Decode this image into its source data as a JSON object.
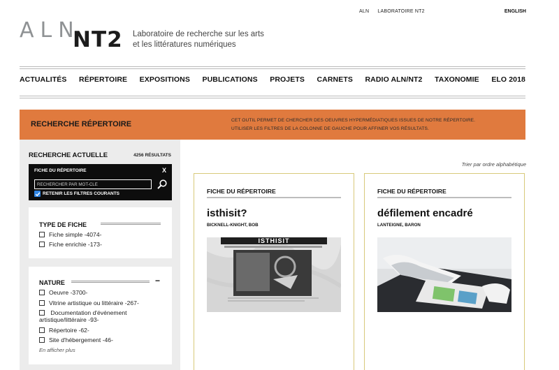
{
  "toplinks": {
    "aln": "ALN",
    "lab": "LABORATOIRE NT2",
    "lang": "ENGLISH"
  },
  "logo": {
    "part1": "ALN",
    "part2": "NT2",
    "tagline_line1": "Laboratoire de recherche sur les arts",
    "tagline_line2": "et les littératures numériques"
  },
  "nav": [
    "ACTUALITÉS",
    "RÉPERTOIRE",
    "EXPOSITIONS",
    "PUBLICATIONS",
    "PROJETS",
    "CARNETS",
    "RADIO ALN/NT2",
    "TAXONOMIE",
    "ELO 2018"
  ],
  "banner": {
    "title": "RECHERCHE RÉPERTOIRE",
    "desc_line1": "CET OUTIL PERMET DE CHERCHER DES OEUVRES HYPERMÉDIATIQUES ISSUES DE NOTRE RÉPERTOIRE.",
    "desc_line2": "UTILISER LES FILTRES DE LA COLONNE DE GAUCHE POUR AFFINER VOS RÉSULTATS.",
    "color": "#e07a3e"
  },
  "sidebar": {
    "heading": "RECHERCHE ACTUELLE",
    "count": "4256 RÉSULTATS",
    "active_filter": "FICHE DU RÉPERTOIRE",
    "close": "X",
    "search_placeholder": "RECHERCHER PAR MOT-CLÉ",
    "retain_label": "RETENIR LES FILTRES COURANTS",
    "type": {
      "title": "TYPE DE FICHE",
      "options": [
        "Fiche simple -4074-",
        "Fiche enrichie -173-"
      ]
    },
    "nature": {
      "title": "NATURE",
      "collapse": "−",
      "options": [
        "Oeuvre -3700-",
        "Vitrine artistique ou littéraire -267-",
        "Documentation d'événement artistique/littéraire -93-",
        "Répertoire -62-",
        "Site d'hébergement -46-"
      ],
      "more": "En afficher plus"
    }
  },
  "content": {
    "sort": "Trier par ordre alphabétique",
    "cards": [
      {
        "header": "FICHE DU RÉPERTOIRE",
        "title": "isthisit?",
        "author": "BICKNELL-KNIGHT, BOB",
        "image": "website-screenshot"
      },
      {
        "header": "FICHE DU RÉPERTOIRE",
        "title": "défilement encadré",
        "author": "LANTEIGNE, BARON",
        "image": "book-installation-photo"
      }
    ]
  }
}
